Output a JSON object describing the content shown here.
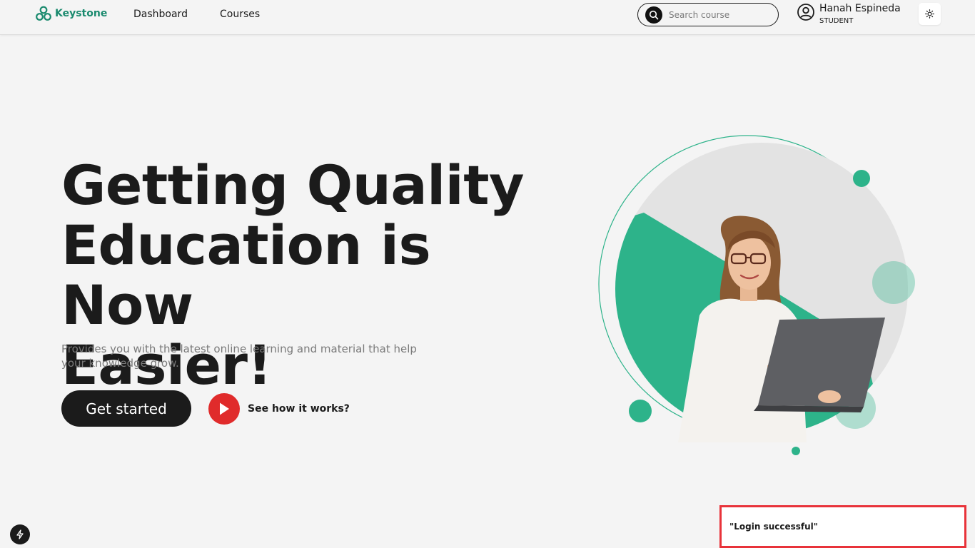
{
  "brand": {
    "name": "Keystone",
    "color": "#1a8a6e"
  },
  "nav": {
    "items": [
      {
        "label": "Dashboard"
      },
      {
        "label": "Courses"
      }
    ]
  },
  "search": {
    "placeholder": "Search course",
    "icon": "search-icon"
  },
  "user": {
    "name": "Hanah Espineda",
    "role": "STUDENT",
    "icon": "user-circle-icon"
  },
  "theme_toggle": {
    "icon": "sun-icon"
  },
  "hero": {
    "title_lines": [
      "Getting Quality",
      "Education is Now",
      "Easier!"
    ],
    "subtitle": "Provides you with the latest online learning and material that help your knowledge grow.",
    "cta_label": "Get started",
    "how_label": "See how it works?"
  },
  "toast": {
    "message": "\"Login successful\""
  },
  "colors": {
    "accent": "#2db38a",
    "dark": "#1b1b1b",
    "play": "#e02b2b",
    "toast_border": "#e8333a"
  }
}
